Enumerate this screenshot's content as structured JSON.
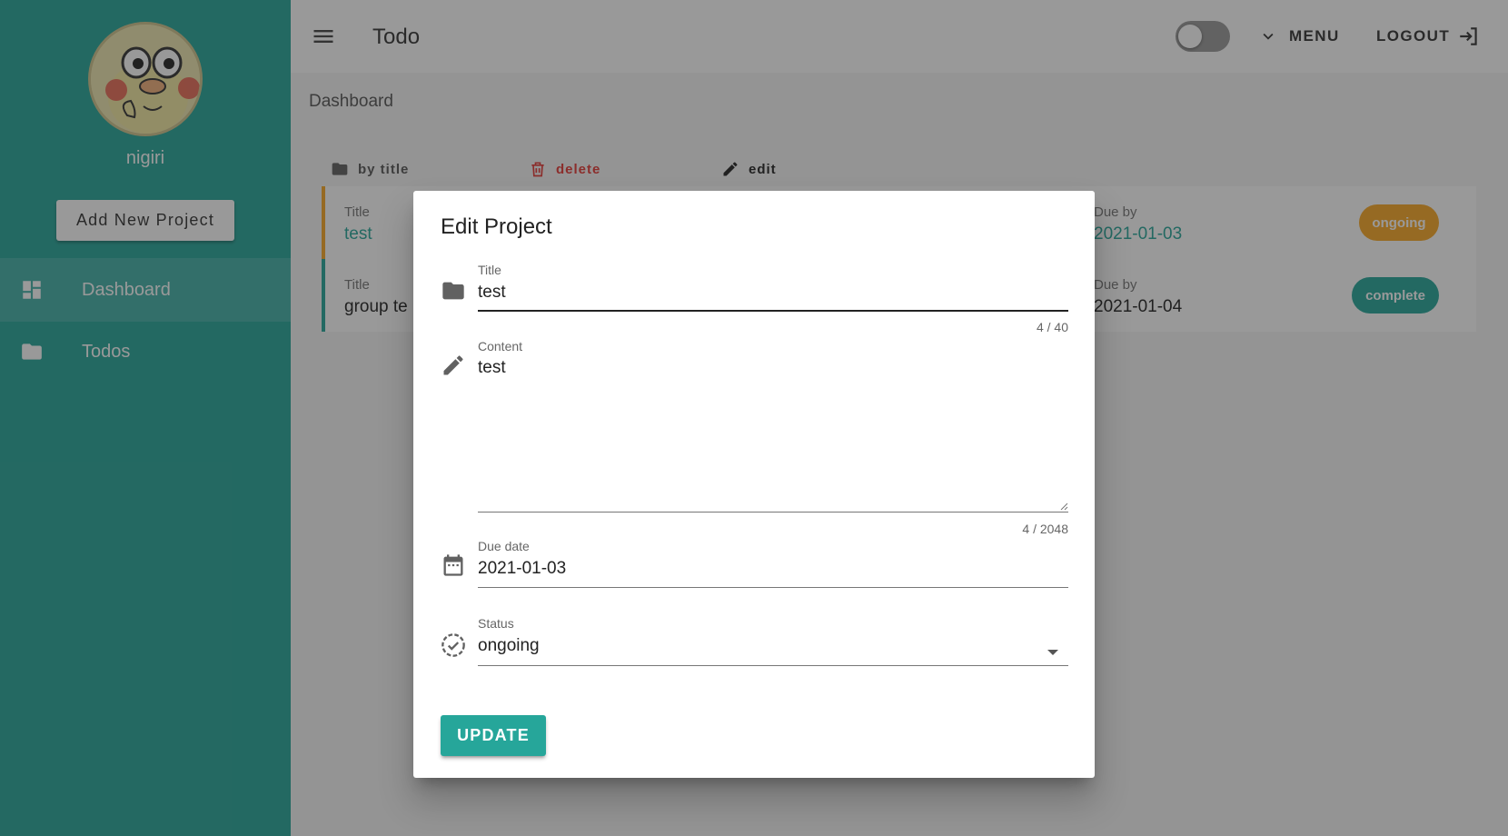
{
  "sidebar": {
    "username": "nigiri",
    "add_button": "Add New Project",
    "items": [
      {
        "label": "Dashboard",
        "icon": "dashboard-icon"
      },
      {
        "label": "Todos",
        "icon": "folder-icon"
      }
    ]
  },
  "topbar": {
    "title": "Todo",
    "menu_label": "MENU",
    "logout_label": "LOGOUT"
  },
  "breadcrumb": "Dashboard",
  "sort_bar": {
    "by_title": "by title",
    "delete": "delete",
    "edit": "edit"
  },
  "projects": [
    {
      "title_label": "Title",
      "title": "test",
      "due_label": "Due by",
      "due": "2021-01-03",
      "status": "ongoing",
      "status_color": "#f9a825"
    },
    {
      "title_label": "Title",
      "title": "group te",
      "due_label": "Due by",
      "due": "2021-01-04",
      "status": "complete",
      "status_color": "#26a69a"
    }
  ],
  "dialog": {
    "title": "Edit Project",
    "title_field": {
      "label": "Title",
      "value": "test",
      "counter": "4 / 40"
    },
    "content_field": {
      "label": "Content",
      "value": "test",
      "counter": "4 / 2048"
    },
    "due_field": {
      "label": "Due date",
      "value": "2021-01-03"
    },
    "status_field": {
      "label": "Status",
      "value": "ongoing"
    },
    "update_button": "UPDATE"
  },
  "colors": {
    "primary": "#26a69a",
    "ongoing": "#f9a825",
    "delete": "#e53935"
  }
}
